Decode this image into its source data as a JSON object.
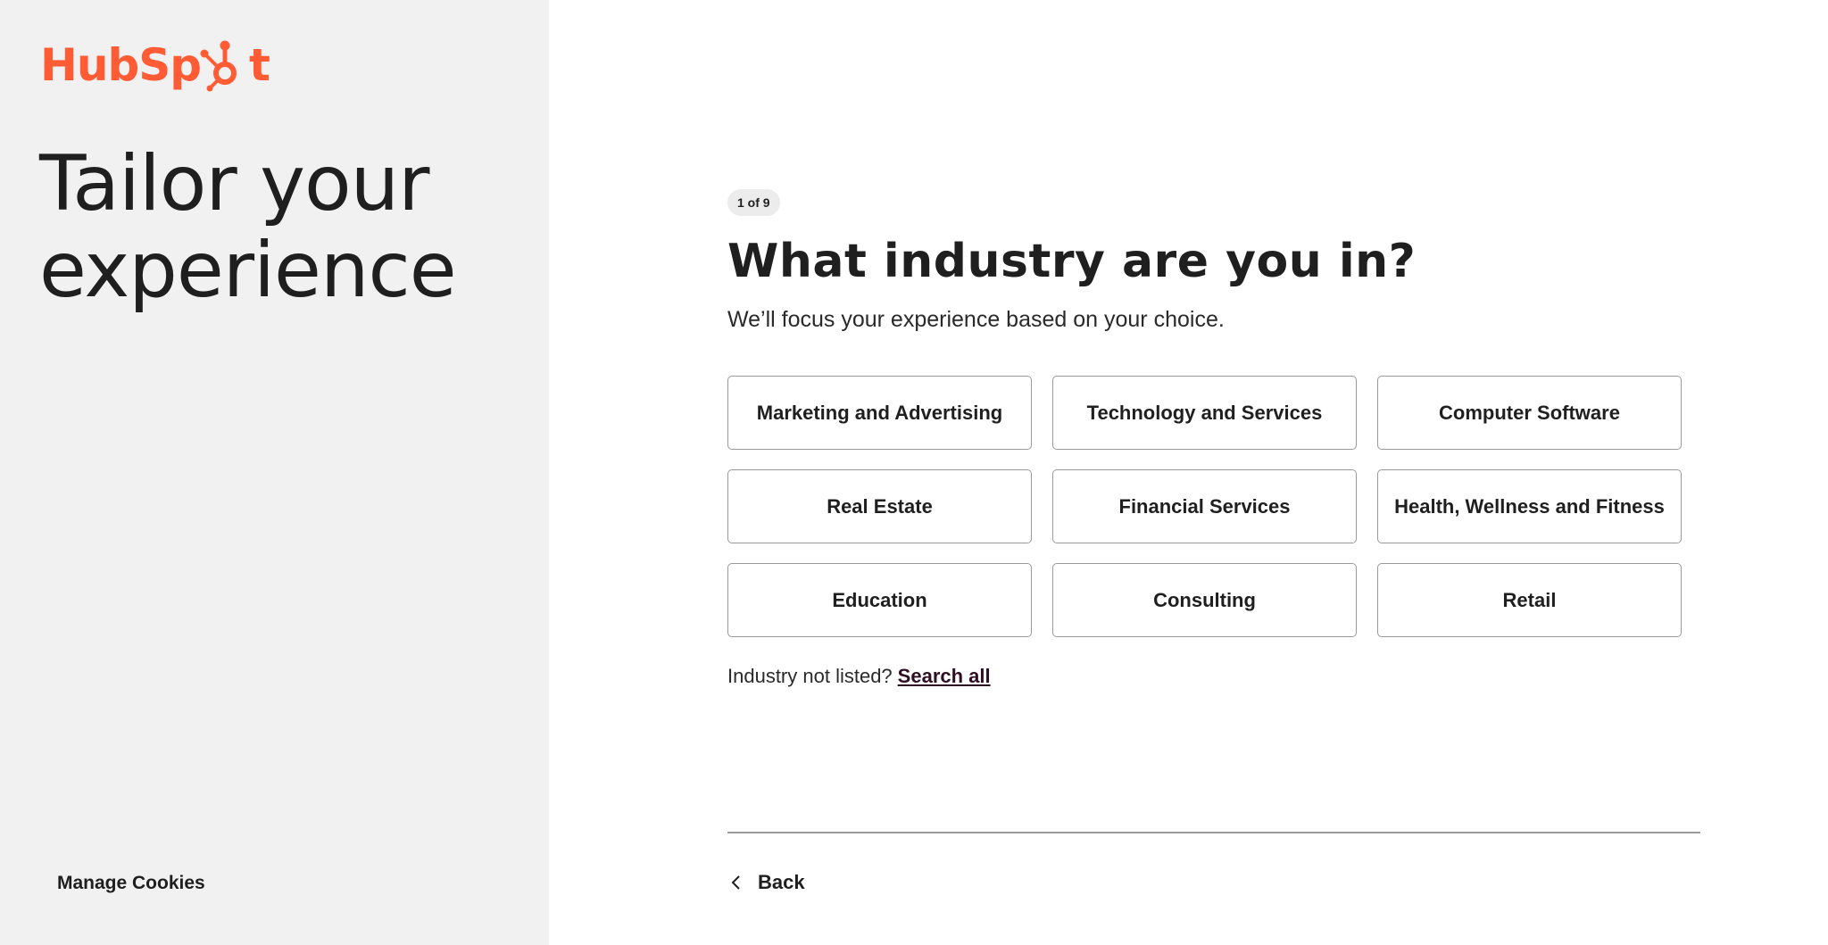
{
  "brand": {
    "logo_text_left": "HubSp",
    "logo_text_right": "t",
    "accent_color": "#ff5c35"
  },
  "sidebar": {
    "hero_title": "Tailor your experience",
    "manage_cookies_label": "Manage Cookies"
  },
  "step": {
    "indicator": "1 of 9"
  },
  "main": {
    "question": "What industry are you in?",
    "subtitle": "We’ll focus your experience based on your choice.",
    "options": [
      "Marketing and Advertising",
      "Technology and Services",
      "Computer Software",
      "Real Estate",
      "Financial Services",
      "Health, Wellness and Fitness",
      "Education",
      "Consulting",
      "Retail"
    ],
    "not_listed_text": "Industry not listed?",
    "search_all_label": "Search all"
  },
  "footer": {
    "back_label": "Back",
    "back_icon": "chevron-left-icon"
  }
}
